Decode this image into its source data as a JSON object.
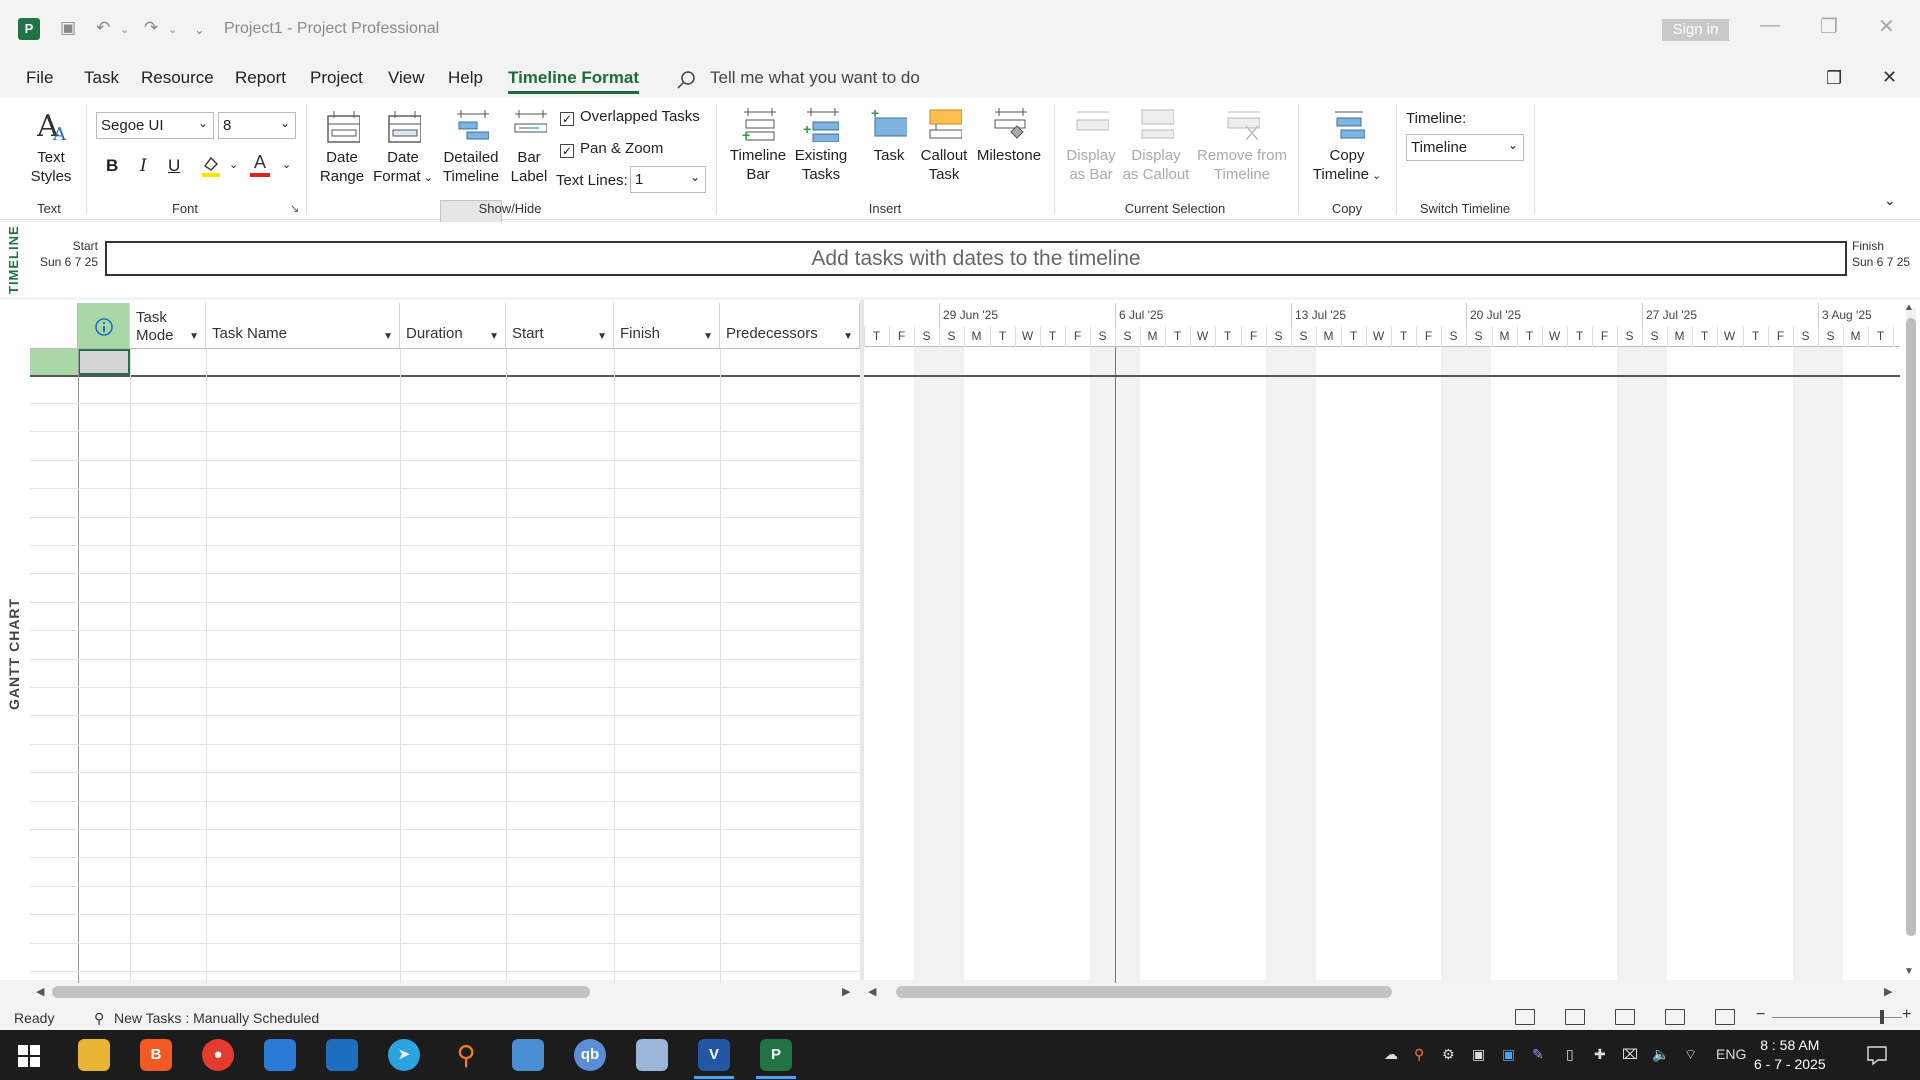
{
  "window": {
    "title": "Project1  -  Project Professional",
    "signin": "Sign in"
  },
  "menu": {
    "tabs": [
      "File",
      "Task",
      "Resource",
      "Report",
      "Project",
      "View",
      "Help",
      "Timeline Format"
    ],
    "active": "Timeline Format",
    "tellme": "Tell me what you want to do"
  },
  "ribbon": {
    "text_styles": "Text Styles",
    "text_styles_line1": "Text",
    "text_styles_line2": "Styles",
    "group_text": "Text",
    "font_name": "Segoe UI",
    "font_size": "8",
    "bold": "B",
    "italic": "I",
    "underline": "U",
    "font_color_glyph": "A",
    "group_font": "Font",
    "date_range_1": "Date",
    "date_range_2": "Range",
    "date_format_1": "Date",
    "date_format_2": "Format",
    "detailed_1": "Detailed",
    "detailed_2": "Timeline",
    "bar_label_1": "Bar",
    "bar_label_2": "Label",
    "overlapped": "Overlapped Tasks",
    "pan_zoom": "Pan & Zoom",
    "text_lines_label": "Text Lines:",
    "text_lines_value": "1",
    "group_showhide": "Show/Hide",
    "timeline_bar_1": "Timeline",
    "timeline_bar_2": "Bar",
    "existing_1": "Existing",
    "existing_2": "Tasks",
    "task": "Task",
    "callout_1": "Callout",
    "callout_2": "Task",
    "milestone": "Milestone",
    "group_insert": "Insert",
    "display_bar_1": "Display",
    "display_bar_2": "as Bar",
    "display_callout_1": "Display",
    "display_callout_2": "as Callout",
    "remove_1": "Remove from",
    "remove_2": "Timeline",
    "group_current": "Current Selection",
    "copy_1": "Copy",
    "copy_2": "Timeline",
    "group_copy": "Copy",
    "switch_label": "Timeline:",
    "switch_value": "Timeline",
    "group_switch": "Switch Timeline"
  },
  "timeline": {
    "side_label": "TIMELINE",
    "start_label": "Start",
    "start_date": "Sun 6 7 25",
    "finish_label": "Finish",
    "finish_date": "Sun 6 7 25",
    "placeholder": "Add tasks with dates to the timeline"
  },
  "gantt": {
    "side_label": "GANTT CHART",
    "columns": [
      {
        "label": "Task Mode",
        "line1": "Task",
        "line2": "Mode"
      },
      {
        "label": "Task Name"
      },
      {
        "label": "Duration"
      },
      {
        "label": "Start"
      },
      {
        "label": "Finish"
      },
      {
        "label": "Predecessors"
      }
    ],
    "weeks": [
      "29 Jun '25",
      "6 Jul '25",
      "13 Jul '25",
      "20 Jul '25",
      "27 Jul '25",
      "3 Aug '25"
    ],
    "days": [
      "T",
      "F",
      "S",
      "S",
      "M",
      "T",
      "W",
      "T",
      "F",
      "S",
      "S",
      "M",
      "T",
      "W",
      "T",
      "F",
      "S",
      "S",
      "M",
      "T",
      "W",
      "T",
      "F",
      "S",
      "S",
      "M",
      "T",
      "W",
      "T",
      "F",
      "S",
      "S",
      "M",
      "T",
      "W",
      "T",
      "F",
      "S",
      "S",
      "M",
      "T",
      "W"
    ]
  },
  "status": {
    "ready": "Ready",
    "new_tasks": "New Tasks : Manually Scheduled"
  },
  "taskbar": {
    "lang": "ENG",
    "time": "8 : 58 AM",
    "date": "6 - 7 - 2025"
  },
  "colors": {
    "accent": "#217346",
    "today_line": "#3c9a5f"
  }
}
